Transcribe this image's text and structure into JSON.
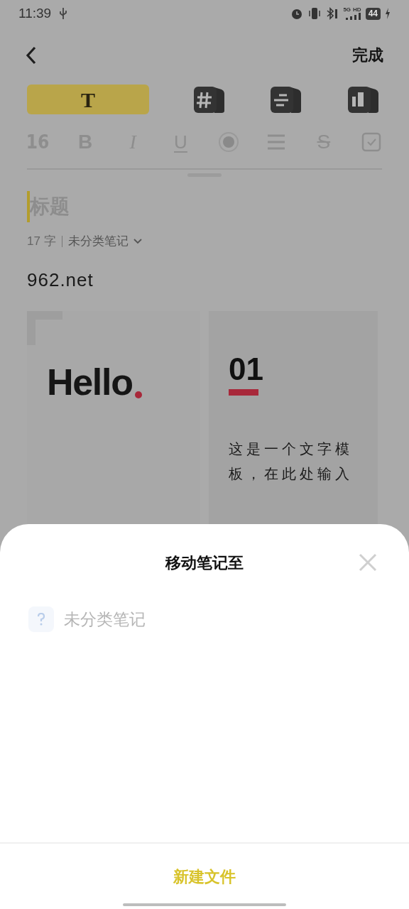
{
  "status_bar": {
    "time": "11:39",
    "network": "5G",
    "network_2": "HD",
    "battery": "44"
  },
  "header": {
    "done": "完成"
  },
  "template_tabs": [
    {
      "kind": "text",
      "label": "T",
      "selected": true
    },
    {
      "kind": "hash",
      "selected": false
    },
    {
      "kind": "lines",
      "selected": false
    },
    {
      "kind": "columns",
      "selected": false
    }
  ],
  "format_tools": [
    {
      "kind": "size",
      "label": "16"
    },
    {
      "kind": "bold",
      "label": "B"
    },
    {
      "kind": "italic",
      "label": "I"
    },
    {
      "kind": "underline",
      "label": "U"
    },
    {
      "kind": "color"
    },
    {
      "kind": "list"
    },
    {
      "kind": "strike",
      "label": "S"
    },
    {
      "kind": "check"
    }
  ],
  "note": {
    "title_placeholder": "标题",
    "count": "17 字",
    "folder": "未分类笔记",
    "body": "962.net"
  },
  "cards": [
    {
      "kind": "hello",
      "text": "Hello"
    },
    {
      "kind": "numbered",
      "number": "01",
      "text": "这是一个文字模板，在此处输入"
    }
  ],
  "sheet": {
    "title": "移动笔记至",
    "folders": [
      {
        "name": "未分类笔记"
      }
    ],
    "new_folder": "新建文件"
  }
}
